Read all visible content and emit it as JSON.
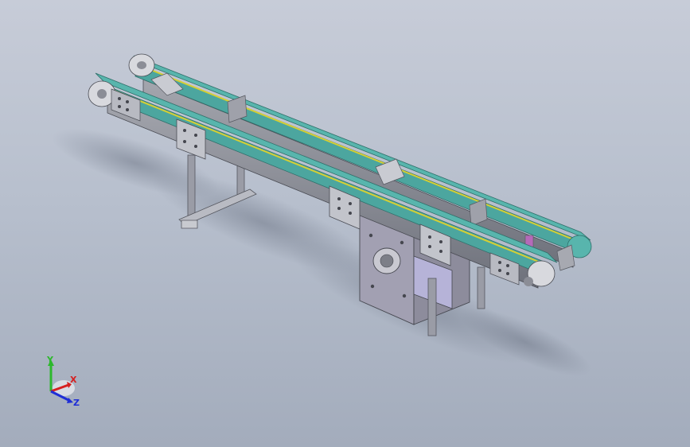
{
  "viewport": {
    "background_top": "#c7ccd8",
    "background_bottom": "#a3acbc"
  },
  "model": {
    "belt_color": "#58b5ad",
    "frame_color": "#8c8e98",
    "stripe_color": "#d6cf33",
    "drive_color": "#a2a0b2",
    "motor_color": "#b6b3d8"
  },
  "triad": {
    "x_label": "X",
    "y_label": "Y",
    "z_label": "Z",
    "x_color": "#d62020",
    "y_color": "#2db82d",
    "z_color": "#1f2ed6"
  }
}
